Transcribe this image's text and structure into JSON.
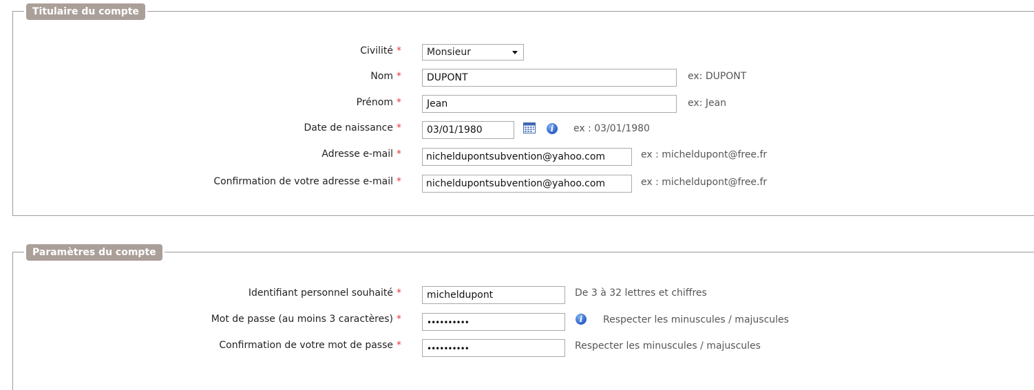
{
  "section1": {
    "legend": "Titulaire du compte",
    "fields": [
      {
        "label": "Civilité",
        "required": "*",
        "value": "Monsieur"
      },
      {
        "label": "Nom",
        "required": "*",
        "value": "DUPONT",
        "hint": "ex: DUPONT"
      },
      {
        "label": "Prénom",
        "required": "*",
        "value": "Jean",
        "hint": "ex: Jean"
      },
      {
        "label": "Date de naissance",
        "required": "*",
        "value": "03/01/1980",
        "hint": "ex : 03/01/1980"
      },
      {
        "label": "Adresse e-mail",
        "required": "*",
        "value": "nicheldupontsubvention@yahoo.com",
        "hint": "ex : micheldupont@free.fr"
      },
      {
        "label": "Confirmation de votre adresse e-mail",
        "required": "*",
        "value": "nicheldupontsubvention@yahoo.com",
        "hint": "ex : micheldupont@free.fr"
      }
    ]
  },
  "section2": {
    "legend": "Paramètres du compte",
    "fields": [
      {
        "label": "Identifiant personnel souhaité",
        "required": "*",
        "value": "micheldupont",
        "hint": "De 3 à 32 lettres et chiffres"
      },
      {
        "label": "Mot de passe (au moins 3 caractères)",
        "required": "*",
        "value": "••••••••••",
        "hint": "Respecter les minuscules / majuscules"
      },
      {
        "label": "Confirmation de votre mot de passe",
        "required": "*",
        "value": "••••••••••",
        "hint": "Respecter les minuscules / majuscules"
      }
    ]
  },
  "icons": {
    "calendar": "calendar-icon",
    "info": "info-icon"
  },
  "colors": {
    "legend_bg": "#ab9f9a",
    "required": "#e03a3a",
    "info": "#2a5fc7"
  }
}
